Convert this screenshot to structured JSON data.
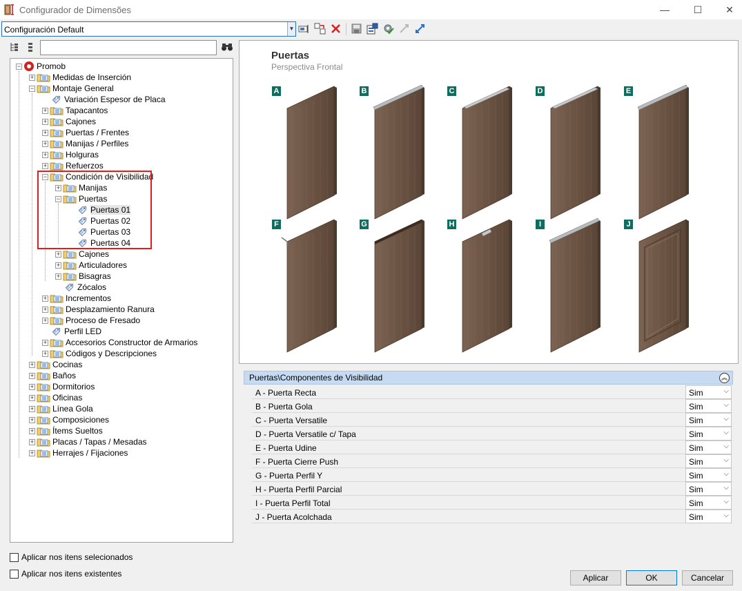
{
  "window": {
    "title": "Configurador de Dimensões",
    "minimize": "—",
    "maximize": "☐",
    "close": "✕"
  },
  "toolbar": {
    "config_value": "Configuración Default",
    "icons": [
      "rename-icon",
      "transfer-icon",
      "delete-icon",
      "save-icon",
      "export-icon",
      "settings-check-icon",
      "collapse-icon",
      "expand-icon"
    ]
  },
  "tree": {
    "root": "Promob",
    "items": [
      "Medidas de Inserción",
      "Montaje General",
      "Variación Espesor de Placa",
      "Tapacantos",
      "Cajones",
      "Puertas / Frentes",
      "Manijas / Perfiles",
      "Holguras",
      "Refuerzos",
      "Condición de Visibilidad",
      "Manijas",
      "Puertas",
      "Puertas 01",
      "Puertas 02",
      "Puertas 03",
      "Puertas 04",
      "Cajones",
      "Articuladores",
      "Bisagras",
      "Zócalos",
      "Incrementos",
      "Desplazamiento Ranura",
      "Proceso de Fresado",
      "Perfil LED",
      "Accesorios Constructor de Armarios",
      "Códigos y Descripciones",
      "Cocinas",
      "Baños",
      "Dormitorios",
      "Oficinas",
      "Línea Gola",
      "Composiciones",
      "Ítems Sueltos",
      "Placas / Tapas / Mesadas",
      "Herrajes / Fijaciones"
    ]
  },
  "options": {
    "apply_selected": "Aplicar nos itens selecionados",
    "apply_existing": "Aplicar nos itens existentes"
  },
  "preview": {
    "title": "Puertas",
    "subtitle": "Perspectiva Frontal",
    "doors": [
      "A",
      "B",
      "C",
      "D",
      "E",
      "F",
      "G",
      "H",
      "I",
      "J"
    ],
    "wood_color": "#6b5444"
  },
  "properties": {
    "header": "Puertas\\Componentes de Visibilidad",
    "rows": [
      {
        "name": "A - Puerta Recta",
        "value": "Sim"
      },
      {
        "name": "B - Puerta Gola",
        "value": "Sim"
      },
      {
        "name": "C - Puerta Versatile",
        "value": "Sim"
      },
      {
        "name": "D - Puerta Versatile c/ Tapa",
        "value": "Sim"
      },
      {
        "name": "E - Puerta Udine",
        "value": "Sim"
      },
      {
        "name": "F - Puerta Cierre Push",
        "value": "Sim"
      },
      {
        "name": "G - Puerta Perfil Y",
        "value": "Sim"
      },
      {
        "name": "H - Puerta Perfil Parcial",
        "value": "Sim"
      },
      {
        "name": "I - Puerta Perfil Total",
        "value": "Sim"
      },
      {
        "name": "J - Puerta Acolchada",
        "value": "Sim"
      }
    ]
  },
  "buttons": {
    "apply": "Aplicar",
    "ok": "OK",
    "cancel": "Cancelar"
  }
}
